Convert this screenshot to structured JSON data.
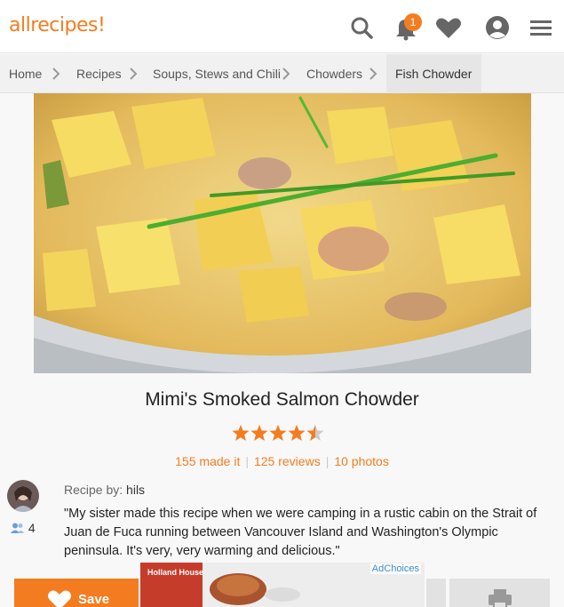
{
  "header": {
    "logo_text": "allrecipes",
    "notification_count": "1",
    "icons": [
      "search-icon",
      "bell-icon",
      "heart-icon",
      "user-icon",
      "menu-icon"
    ],
    "brand_color": "#f47c20"
  },
  "breadcrumb": [
    "Home",
    "Recipes",
    "Soups, Stews and Chili",
    "Chowders",
    "Fish Chowder"
  ],
  "recipe": {
    "title": "Mimi's Smoked Salmon Chowder",
    "rating": 4.5,
    "made_it": "155 made it",
    "reviews": "125 reviews",
    "photos": "10 photos",
    "recipe_by_label": "Recipe by:",
    "author": "hils",
    "followers": "4",
    "description": "\"My sister made this recipe when we were camping in a rustic cabin on the Strait of Juan de Fuca running between Vancouver Island and Washington's Olympic peninsula. It's very, very warming and delicious.\""
  },
  "actions": {
    "save_label": "Save"
  },
  "ad": {
    "adchoices_label": "AdChoices",
    "brand_text": "Holland House"
  }
}
